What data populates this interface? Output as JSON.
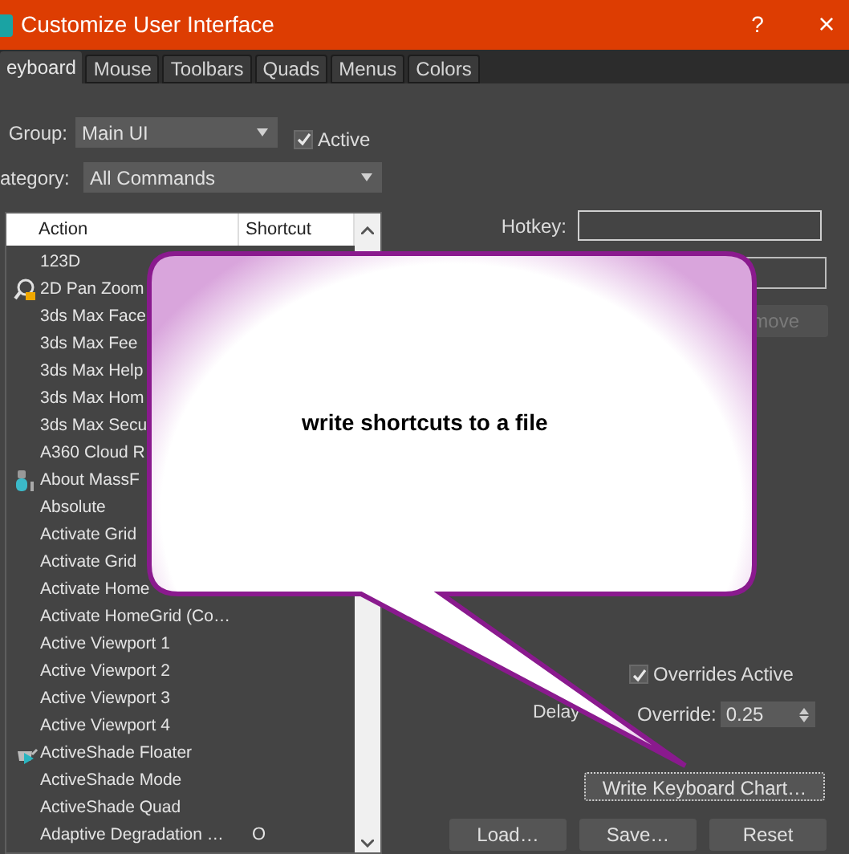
{
  "window": {
    "title": "Customize User Interface",
    "help": "?",
    "close": "×"
  },
  "tabs": [
    {
      "label": "eyboard",
      "selected": true
    },
    {
      "label": "Mouse",
      "selected": false
    },
    {
      "label": "Toolbars",
      "selected": false
    },
    {
      "label": "Quads",
      "selected": false
    },
    {
      "label": "Menus",
      "selected": false
    },
    {
      "label": "Colors",
      "selected": false
    }
  ],
  "group": {
    "label": "Group:",
    "value": "Main UI",
    "active": {
      "label": "Active",
      "checked": true
    }
  },
  "category": {
    "label": "ategory:",
    "value": "All Commands"
  },
  "table": {
    "columns": [
      "Action",
      "Shortcut"
    ],
    "rows": [
      {
        "action": "123D"
      },
      {
        "action": "2D Pan Zoom"
      },
      {
        "action": "3ds Max Face"
      },
      {
        "action": "3ds Max Fee"
      },
      {
        "action": "3ds Max Help"
      },
      {
        "action": "3ds Max Hom"
      },
      {
        "action": "3ds Max Secu"
      },
      {
        "action": "A360 Cloud R"
      },
      {
        "action": "About MassF"
      },
      {
        "action": "Absolute"
      },
      {
        "action": "Activate Grid"
      },
      {
        "action": "Activate Grid"
      },
      {
        "action": "Activate Home"
      },
      {
        "action": "Activate HomeGrid (Co…"
      },
      {
        "action": "Active Viewport 1"
      },
      {
        "action": "Active Viewport 2"
      },
      {
        "action": "Active Viewport 3"
      },
      {
        "action": "Active Viewport 4"
      },
      {
        "action": "ActiveShade Floater"
      },
      {
        "action": "ActiveShade Mode"
      },
      {
        "action": "ActiveShade Quad"
      },
      {
        "action": "Adaptive Degradation …",
        "shortcut": "O"
      }
    ]
  },
  "hotkey": {
    "label": "Hotkey:"
  },
  "remove_button": {
    "label": "move",
    "disabled": true
  },
  "overrides_active": {
    "label": "Overrides Active",
    "checked": true
  },
  "delay": {
    "label_start": "Delay",
    "label_end": "Override:",
    "value": "0.25"
  },
  "write_chart_button": "Write Keyboard Chart…",
  "buttons": [
    "Load…",
    "Save…",
    "Reset"
  ],
  "callout": {
    "text": "write shortcuts to a file"
  }
}
